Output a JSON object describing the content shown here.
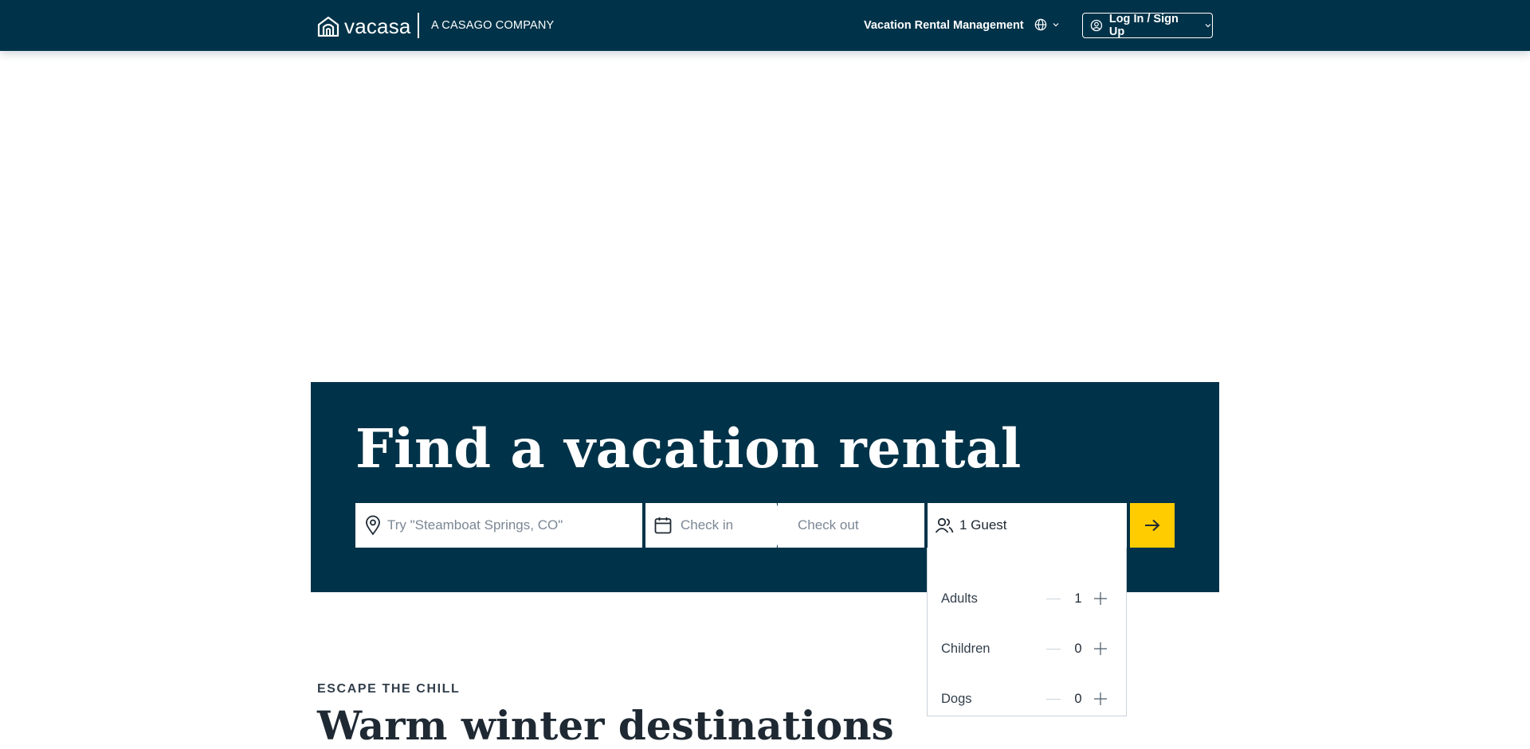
{
  "header": {
    "logo_text": "vacasa",
    "tagline": "A CASAGO COMPANY",
    "nav_link": "Vacation Rental Management",
    "language_icon": "globe-icon",
    "login_label": "Log In / Sign Up"
  },
  "hero": {
    "title": "Find a vacation rental"
  },
  "search": {
    "location_placeholder": "Try \"Steamboat Springs, CO\"",
    "checkin_placeholder": "Check in",
    "checkout_placeholder": "Check out",
    "guests_value": "1 Guest",
    "submit_icon": "arrow-right-icon"
  },
  "guest_picker": {
    "rows": [
      {
        "label": "Adults",
        "count": "1"
      },
      {
        "label": "Children",
        "count": "0"
      },
      {
        "label": "Dogs",
        "count": "0"
      }
    ]
  },
  "section": {
    "eyebrow": "ESCAPE THE CHILL",
    "heading": "Warm winter destinations"
  },
  "colors": {
    "brand_navy": "#003349",
    "accent_yellow": "#ffcc00",
    "white": "#ffffff"
  }
}
